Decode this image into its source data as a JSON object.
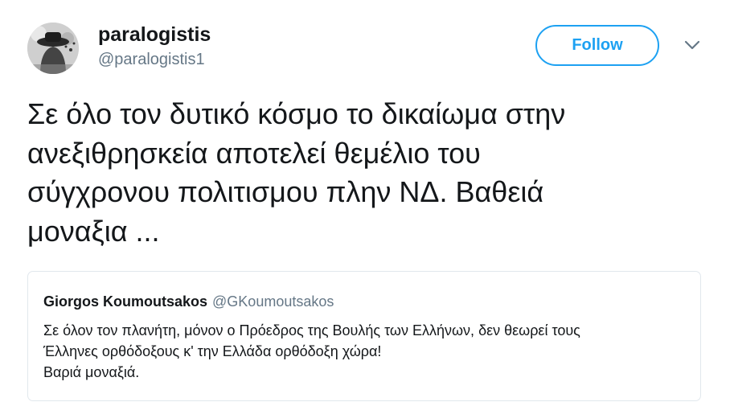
{
  "tweet": {
    "author": {
      "name": "paralogistis",
      "handle": "@paralogistis1"
    },
    "follow_label": "Follow",
    "text": "Σε όλο τον δυτικό κόσμο το δικαίωμα στην\nανεξιθρησκεία αποτελεί θεμέλιο του\nσύγχρονου πολιτισμου πλην ΝΔ. Βαθειά\nμοναξια ..."
  },
  "quoted_tweet": {
    "name": "Giorgos Koumoutsakos",
    "handle": "@GKoumoutsakos",
    "text": "Σε όλον τον πλανήτη, μόνον ο Πρόεδρος της Βουλής των Ελλήνων, δεν θεωρεί τους\nΈλληνες ορθόδοξους κ' την Ελλάδα ορθόδοξη χώρα!\nΒαριά μοναξιά."
  },
  "colors": {
    "accent": "#1da1f2",
    "text_primary": "#14171a",
    "text_secondary": "#657786",
    "border": "#e1e8ed"
  },
  "icons": {
    "more": "chevron-down-icon"
  }
}
